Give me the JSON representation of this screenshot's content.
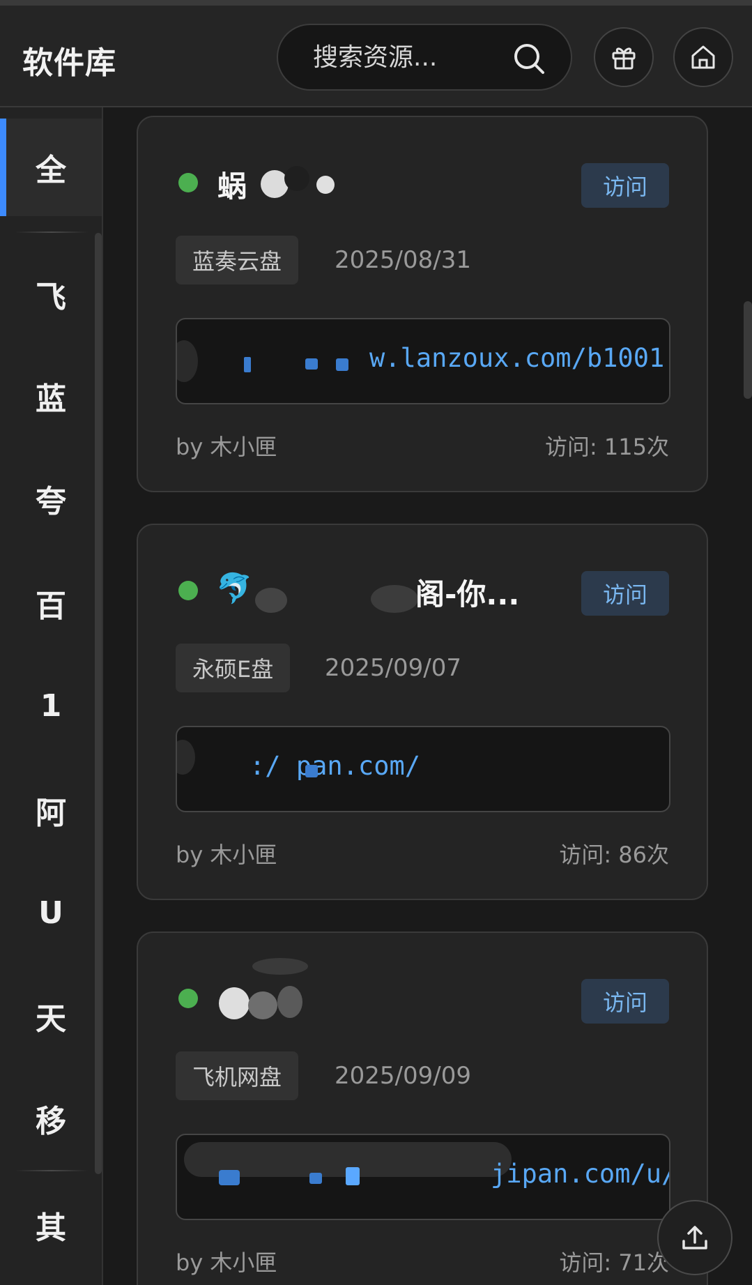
{
  "header": {
    "title": "软件库",
    "search_placeholder": "搜索资源...",
    "icons": [
      "search-icon",
      "gift-icon",
      "home-icon"
    ]
  },
  "sidebar": {
    "items": [
      {
        "label": "全",
        "active": true
      },
      {
        "label": "飞"
      },
      {
        "label": "蓝"
      },
      {
        "label": "夸"
      },
      {
        "label": "百"
      },
      {
        "label": "1"
      },
      {
        "label": "阿"
      },
      {
        "label": "U"
      },
      {
        "label": "天"
      },
      {
        "label": "移"
      },
      {
        "label": "其"
      }
    ]
  },
  "cards": [
    {
      "title": "蜗",
      "visit_label": "访问",
      "tag": "蓝奏云盘",
      "date": "2025/08/31",
      "link": "w.lanzoux.com/b1001",
      "author": "by 木小匣",
      "visits": "访问: 115次"
    },
    {
      "title": "阁-你...",
      "title_emoji": "🐬",
      "visit_label": "访问",
      "tag": "永硕E盘",
      "date": "2025/09/07",
      "link": ":/ pan.com/",
      "author": "by 木小匣",
      "visits": "访问: 86次"
    },
    {
      "title": "",
      "visit_label": "访问",
      "tag": "飞机网盘",
      "date": "2025/09/09",
      "link": "jipan.com/u/",
      "author": "by 木小匣",
      "visits": "访问: 71次"
    }
  ],
  "colors": {
    "accent": "#3d8bfd",
    "link": "#59a8f5",
    "status_online": "#4caf50",
    "visit_button_bg": "#2c3a4c"
  },
  "fab": {
    "icon": "upload-icon"
  }
}
